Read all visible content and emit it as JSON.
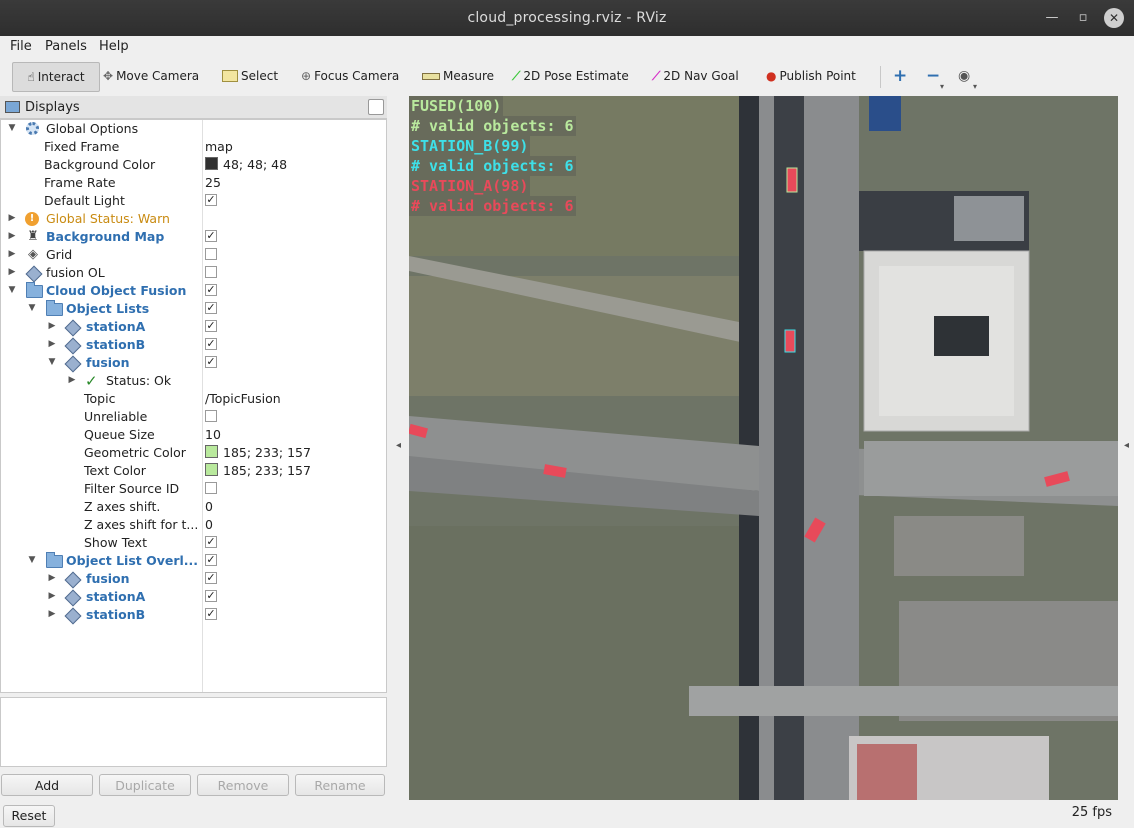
{
  "window": {
    "title": "cloud_processing.rviz - RViz"
  },
  "menu": {
    "file": "File",
    "panels": "Panels",
    "help": "Help"
  },
  "toolbar": {
    "interact": "Interact",
    "move_camera": "Move Camera",
    "select": "Select",
    "focus_camera": "Focus Camera",
    "measure": "Measure",
    "pose_estimate": "2D Pose Estimate",
    "nav_goal": "2D Nav Goal",
    "publish_point": "Publish Point"
  },
  "displays": {
    "title": "Displays",
    "rows": [
      {
        "label": "Global Options"
      },
      {
        "label": "Fixed Frame",
        "value": "map"
      },
      {
        "label": "Background Color",
        "value": "48; 48; 48",
        "swatch": "#303030"
      },
      {
        "label": "Frame Rate",
        "value": "25"
      },
      {
        "label": "Default Light",
        "checked": true
      },
      {
        "label": "Global Status: Warn"
      },
      {
        "label": "Background Map",
        "checked": true
      },
      {
        "label": "Grid",
        "checked": false
      },
      {
        "label": "fusion OL",
        "checked": false
      },
      {
        "label": "Cloud Object Fusion",
        "checked": true
      },
      {
        "label": "Object Lists",
        "checked": true
      },
      {
        "label": "stationA",
        "checked": true
      },
      {
        "label": "stationB",
        "checked": true
      },
      {
        "label": "fusion",
        "checked": true
      },
      {
        "label": "Status: Ok"
      },
      {
        "label": "Topic",
        "value": "/TopicFusion"
      },
      {
        "label": "Unreliable",
        "checked": false
      },
      {
        "label": "Queue Size",
        "value": "10"
      },
      {
        "label": "Geometric Color",
        "value": "185; 233; 157",
        "swatch": "#b9e99d"
      },
      {
        "label": "Text Color",
        "value": "185; 233; 157",
        "swatch": "#b9e99d"
      },
      {
        "label": "Filter Source ID",
        "checked": false
      },
      {
        "label": "Z axes shift.",
        "value": "0"
      },
      {
        "label": "Z axes shift for t...",
        "value": "0"
      },
      {
        "label": "Show Text",
        "checked": true
      },
      {
        "label": "Object List Overl...",
        "checked": true
      },
      {
        "label": "fusion",
        "checked": true
      },
      {
        "label": "stationA",
        "checked": true
      },
      {
        "label": "stationB",
        "checked": true
      }
    ],
    "buttons": {
      "add": "Add",
      "duplicate": "Duplicate",
      "remove": "Remove",
      "rename": "Rename"
    }
  },
  "overlay": {
    "lines": [
      {
        "text": "FUSED(100)",
        "color": "#b9e99d"
      },
      {
        "text": "# valid objects: 6",
        "color": "#b9e99d"
      },
      {
        "text": "STATION_B(99)",
        "color": "#3ee0e8"
      },
      {
        "text": "# valid objects: 6",
        "color": "#3ee0e8"
      },
      {
        "text": "STATION_A(98)",
        "color": "#e84a5a"
      },
      {
        "text": "# valid objects: 6",
        "color": "#e84a5a"
      }
    ]
  },
  "status": {
    "reset": "Reset",
    "fps": "25 fps"
  }
}
